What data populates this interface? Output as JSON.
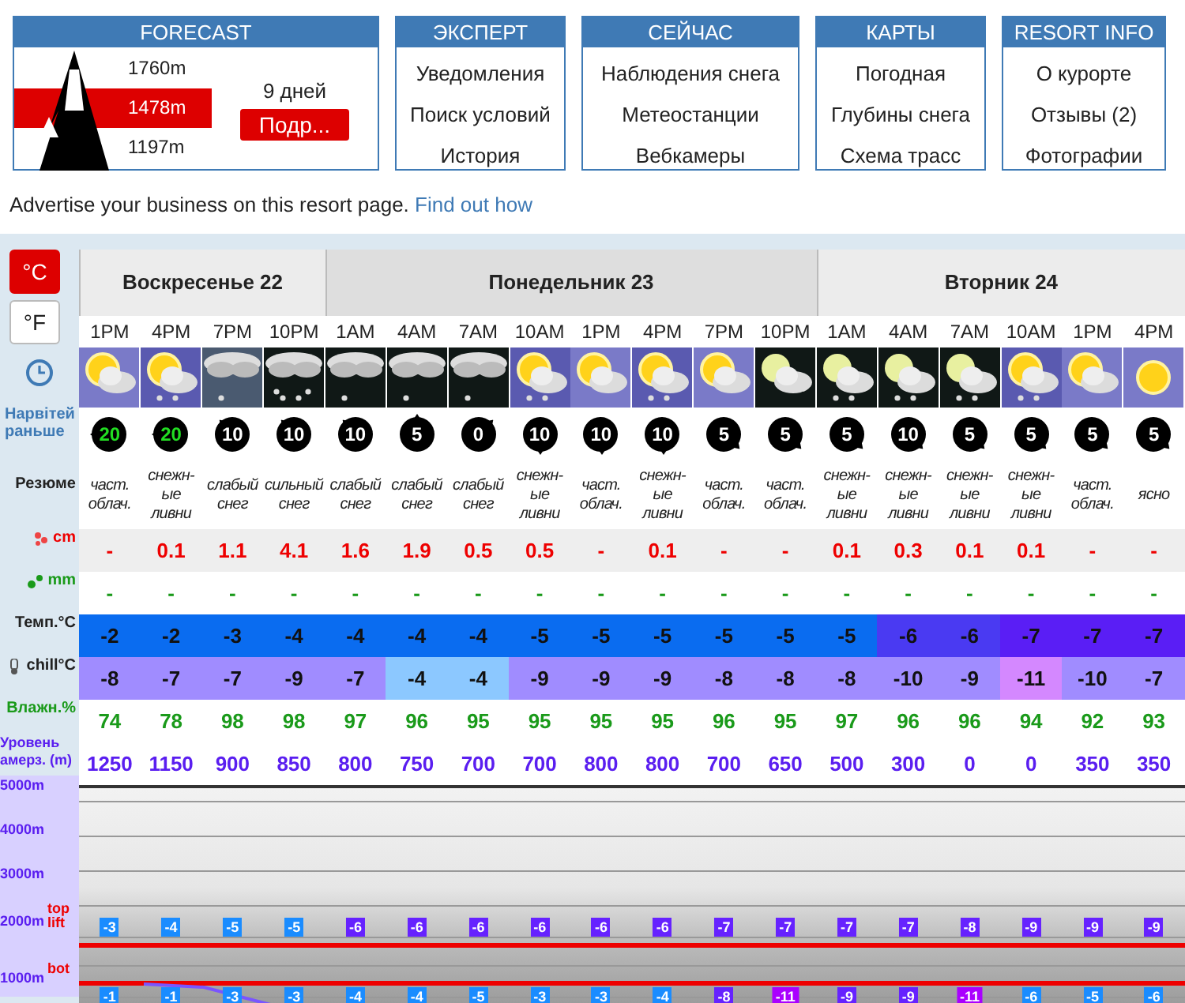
{
  "forecast_box": {
    "title": "FORECAST",
    "elevations": [
      {
        "label": "1760m",
        "selected": false
      },
      {
        "label": "1478m",
        "selected": true
      },
      {
        "label": "1197m",
        "selected": false
      }
    ],
    "days_label": "9 дней",
    "button": "Подр..."
  },
  "menus": [
    {
      "title": "ЭКСПЕРТ",
      "items": [
        "Уведомления",
        "Поиск условий",
        "История"
      ]
    },
    {
      "title": "СЕЙЧАС",
      "items": [
        "Наблюдения снега",
        "Метеостанции",
        "Вебкамеры"
      ]
    },
    {
      "title": "КАРТЫ",
      "items": [
        "Погодная",
        "Глубины снега",
        "Схема трасс"
      ]
    },
    {
      "title": "RESORT INFO",
      "items": [
        "О курорте",
        "Отзывы (2)",
        "Фотографии"
      ]
    }
  ],
  "advert": {
    "text": "Advertise your business on this resort page.",
    "link": "Find out how"
  },
  "units": [
    {
      "label": "°C",
      "selected": true
    },
    {
      "label": "°F",
      "selected": false
    }
  ],
  "row_labels": {
    "wind": "Нарвітей раньше",
    "summary": "Резюме",
    "snow": "cm",
    "rain": "mm",
    "temp": "Темп.°C",
    "chill": "chill°C",
    "humidity": "Влажн.%",
    "freezing": "Уровень амерз. (m)"
  },
  "chart_labels": {
    "altitudes": [
      "5000m",
      "4000m",
      "3000m",
      "2000m",
      "1000m"
    ],
    "top_lift": "top lift",
    "bot_lift": "bot"
  },
  "days": [
    {
      "name": "Воскресенье 22",
      "periods": [
        {
          "time": "1PM",
          "icon": {
            "kind": "sun-cloud"
          },
          "wind": {
            "speed": "20",
            "kind": "w",
            "strong": true
          },
          "summary": "част. облач.",
          "snow": "-",
          "rain": "-",
          "temp": {
            "value": "-2",
            "color": "#0a6cf0"
          },
          "chill": {
            "value": "-8",
            "color": "#a08cff"
          },
          "humidity": "74",
          "freezing": "1250",
          "top_lift": {
            "value": "-3",
            "color": "#1a8cff"
          },
          "bot_lift": {
            "value": "-1",
            "color": "#1a8cff"
          }
        },
        {
          "time": "4PM",
          "icon": {
            "kind": "sun-cloud-snow"
          },
          "wind": {
            "speed": "20",
            "kind": "w",
            "strong": true
          },
          "summary": "снежн-ые ливни",
          "snow": "0.1",
          "rain": "-",
          "temp": {
            "value": "-2",
            "color": "#0a6cf0"
          },
          "chill": {
            "value": "-7",
            "color": "#a08cff"
          },
          "humidity": "78",
          "freezing": "1150",
          "top_lift": {
            "value": "-4",
            "color": "#1a8cff"
          },
          "bot_lift": {
            "value": "-1",
            "color": "#1a8cff"
          }
        },
        {
          "time": "7PM",
          "icon": {
            "kind": "cloud-snow-dusk"
          },
          "wind": {
            "speed": "10",
            "kind": "nw",
            "strong": false
          },
          "summary": "слабый снег",
          "snow": "1.1",
          "rain": "-",
          "temp": {
            "value": "-3",
            "color": "#0a6cf0"
          },
          "chill": {
            "value": "-7",
            "color": "#a08cff"
          },
          "humidity": "98",
          "freezing": "900",
          "top_lift": {
            "value": "-5",
            "color": "#1a8cff"
          },
          "bot_lift": {
            "value": "-3",
            "color": "#1a8cff"
          }
        },
        {
          "time": "10PM",
          "icon": {
            "kind": "cloud-heavy-snow"
          },
          "wind": {
            "speed": "10",
            "kind": "nw",
            "strong": false
          },
          "summary": "сильный снег",
          "snow": "4.1",
          "rain": "-",
          "temp": {
            "value": "-4",
            "color": "#0a6cf0"
          },
          "chill": {
            "value": "-9",
            "color": "#a08cff"
          },
          "humidity": "98",
          "freezing": "850",
          "top_lift": {
            "value": "-5",
            "color": "#1a8cff"
          },
          "bot_lift": {
            "value": "-3",
            "color": "#1a8cff"
          }
        }
      ]
    },
    {
      "name": "Понедельник 23",
      "periods": [
        {
          "time": "1AM",
          "icon": {
            "kind": "cloud-snow-night"
          },
          "wind": {
            "speed": "10",
            "kind": "nw",
            "strong": false
          },
          "summary": "слабый снег",
          "snow": "1.6",
          "rain": "-",
          "temp": {
            "value": "-4",
            "color": "#0a6cf0"
          },
          "chill": {
            "value": "-7",
            "color": "#a08cff"
          },
          "humidity": "97",
          "freezing": "800",
          "top_lift": {
            "value": "-6",
            "color": "#6622ff"
          },
          "bot_lift": {
            "value": "-4",
            "color": "#1a8cff"
          }
        },
        {
          "time": "4AM",
          "icon": {
            "kind": "cloud-snow-night"
          },
          "wind": {
            "speed": "5",
            "kind": "n",
            "strong": false
          },
          "summary": "слабый снег",
          "snow": "1.9",
          "rain": "-",
          "temp": {
            "value": "-4",
            "color": "#0a6cf0"
          },
          "chill": {
            "value": "-4",
            "color": "#8cc8ff"
          },
          "humidity": "96",
          "freezing": "750",
          "top_lift": {
            "value": "-6",
            "color": "#6622ff"
          },
          "bot_lift": {
            "value": "-4",
            "color": "#1a8cff"
          }
        },
        {
          "time": "7AM",
          "icon": {
            "kind": "cloud-snow-night"
          },
          "wind": {
            "speed": "0",
            "kind": "ne",
            "strong": false
          },
          "summary": "слабый снег",
          "snow": "0.5",
          "rain": "-",
          "temp": {
            "value": "-4",
            "color": "#0a6cf0"
          },
          "chill": {
            "value": "-4",
            "color": "#8cc8ff"
          },
          "humidity": "95",
          "freezing": "700",
          "top_lift": {
            "value": "-6",
            "color": "#6622ff"
          },
          "bot_lift": {
            "value": "-5",
            "color": "#1a8cff"
          }
        },
        {
          "time": "10AM",
          "icon": {
            "kind": "sun-cloud-snow"
          },
          "wind": {
            "speed": "10",
            "kind": "s",
            "strong": false
          },
          "summary": "снежн-ые ливни",
          "snow": "0.5",
          "rain": "-",
          "temp": {
            "value": "-5",
            "color": "#0a6cf0"
          },
          "chill": {
            "value": "-9",
            "color": "#a08cff"
          },
          "humidity": "95",
          "freezing": "700",
          "top_lift": {
            "value": "-6",
            "color": "#6622ff"
          },
          "bot_lift": {
            "value": "-3",
            "color": "#1a8cff"
          }
        },
        {
          "time": "1PM",
          "icon": {
            "kind": "sun-cloud"
          },
          "wind": {
            "speed": "10",
            "kind": "s",
            "strong": false
          },
          "summary": "част. облач.",
          "snow": "-",
          "rain": "-",
          "temp": {
            "value": "-5",
            "color": "#0a6cf0"
          },
          "chill": {
            "value": "-9",
            "color": "#a08cff"
          },
          "humidity": "95",
          "freezing": "800",
          "top_lift": {
            "value": "-6",
            "color": "#6622ff"
          },
          "bot_lift": {
            "value": "-3",
            "color": "#1a8cff"
          }
        },
        {
          "time": "4PM",
          "icon": {
            "kind": "sun-cloud-snow"
          },
          "wind": {
            "speed": "10",
            "kind": "s",
            "strong": false
          },
          "summary": "снежн-ые ливни",
          "snow": "0.1",
          "rain": "-",
          "temp": {
            "value": "-5",
            "color": "#0a6cf0"
          },
          "chill": {
            "value": "-9",
            "color": "#a08cff"
          },
          "humidity": "95",
          "freezing": "800",
          "top_lift": {
            "value": "-6",
            "color": "#6622ff"
          },
          "bot_lift": {
            "value": "-4",
            "color": "#1a8cff"
          }
        },
        {
          "time": "7PM",
          "icon": {
            "kind": "sun-cloud"
          },
          "wind": {
            "speed": "5",
            "kind": "se",
            "strong": false
          },
          "summary": "част. облач.",
          "snow": "-",
          "rain": "-",
          "temp": {
            "value": "-5",
            "color": "#0a6cf0"
          },
          "chill": {
            "value": "-8",
            "color": "#a08cff"
          },
          "humidity": "96",
          "freezing": "700",
          "top_lift": {
            "value": "-7",
            "color": "#6622ff"
          },
          "bot_lift": {
            "value": "-8",
            "color": "#6622ff"
          }
        },
        {
          "time": "10PM",
          "icon": {
            "kind": "moon-cloud"
          },
          "wind": {
            "speed": "5",
            "kind": "se",
            "strong": false
          },
          "summary": "част. облач.",
          "snow": "-",
          "rain": "-",
          "temp": {
            "value": "-5",
            "color": "#0a6cf0"
          },
          "chill": {
            "value": "-8",
            "color": "#a08cff"
          },
          "humidity": "95",
          "freezing": "650",
          "top_lift": {
            "value": "-7",
            "color": "#6622ff"
          },
          "bot_lift": {
            "value": "-11",
            "color": "#aa00ff"
          }
        }
      ]
    },
    {
      "name": "Вторник 24",
      "periods": [
        {
          "time": "1AM",
          "icon": {
            "kind": "moon-cloud-snow"
          },
          "wind": {
            "speed": "5",
            "kind": "se",
            "strong": false
          },
          "summary": "снежн-ые ливни",
          "snow": "0.1",
          "rain": "-",
          "temp": {
            "value": "-5",
            "color": "#0a6cf0"
          },
          "chill": {
            "value": "-8",
            "color": "#a08cff"
          },
          "humidity": "97",
          "freezing": "500",
          "top_lift": {
            "value": "-7",
            "color": "#6622ff"
          },
          "bot_lift": {
            "value": "-9",
            "color": "#6622ff"
          }
        },
        {
          "time": "4AM",
          "icon": {
            "kind": "moon-cloud-snow"
          },
          "wind": {
            "speed": "10",
            "kind": "se",
            "strong": false
          },
          "summary": "снежн-ые ливни",
          "snow": "0.3",
          "rain": "-",
          "temp": {
            "value": "-6",
            "color": "#4a3af2"
          },
          "chill": {
            "value": "-10",
            "color": "#a08cff"
          },
          "humidity": "96",
          "freezing": "300",
          "top_lift": {
            "value": "-7",
            "color": "#6622ff"
          },
          "bot_lift": {
            "value": "-9",
            "color": "#6622ff"
          }
        },
        {
          "time": "7AM",
          "icon": {
            "kind": "moon-cloud-snow"
          },
          "wind": {
            "speed": "5",
            "kind": "se",
            "strong": false
          },
          "summary": "снежн-ые ливни",
          "snow": "0.1",
          "rain": "-",
          "temp": {
            "value": "-6",
            "color": "#4a3af2"
          },
          "chill": {
            "value": "-9",
            "color": "#a08cff"
          },
          "humidity": "96",
          "freezing": "0",
          "top_lift": {
            "value": "-8",
            "color": "#6622ff"
          },
          "bot_lift": {
            "value": "-11",
            "color": "#aa00ff"
          }
        },
        {
          "time": "10AM",
          "icon": {
            "kind": "sun-cloud-snow"
          },
          "wind": {
            "speed": "5",
            "kind": "se",
            "strong": false
          },
          "summary": "снежн-ые ливни",
          "snow": "0.1",
          "rain": "-",
          "temp": {
            "value": "-7",
            "color": "#5a1ef5"
          },
          "chill": {
            "value": "-11",
            "color": "#d488ff"
          },
          "humidity": "94",
          "freezing": "0",
          "top_lift": {
            "value": "-9",
            "color": "#6622ff"
          },
          "bot_lift": {
            "value": "-6",
            "color": "#1a8cff"
          }
        },
        {
          "time": "1PM",
          "icon": {
            "kind": "sun-cloud"
          },
          "wind": {
            "speed": "5",
            "kind": "se",
            "strong": false
          },
          "summary": "част. облач.",
          "snow": "-",
          "rain": "-",
          "temp": {
            "value": "-7",
            "color": "#5a1ef5"
          },
          "chill": {
            "value": "-10",
            "color": "#a08cff"
          },
          "humidity": "92",
          "freezing": "350",
          "top_lift": {
            "value": "-9",
            "color": "#6622ff"
          },
          "bot_lift": {
            "value": "-5",
            "color": "#1a8cff"
          }
        },
        {
          "time": "4PM",
          "icon": {
            "kind": "sun"
          },
          "wind": {
            "speed": "5",
            "kind": "se",
            "strong": false
          },
          "summary": "ясно",
          "snow": "-",
          "rain": "-",
          "temp": {
            "value": "-7",
            "color": "#5a1ef5"
          },
          "chill": {
            "value": "-7",
            "color": "#a08cff"
          },
          "humidity": "93",
          "freezing": "350",
          "top_lift": {
            "value": "-9",
            "color": "#6622ff"
          },
          "bot_lift": {
            "value": "-6",
            "color": "#1a8cff"
          }
        }
      ]
    }
  ]
}
